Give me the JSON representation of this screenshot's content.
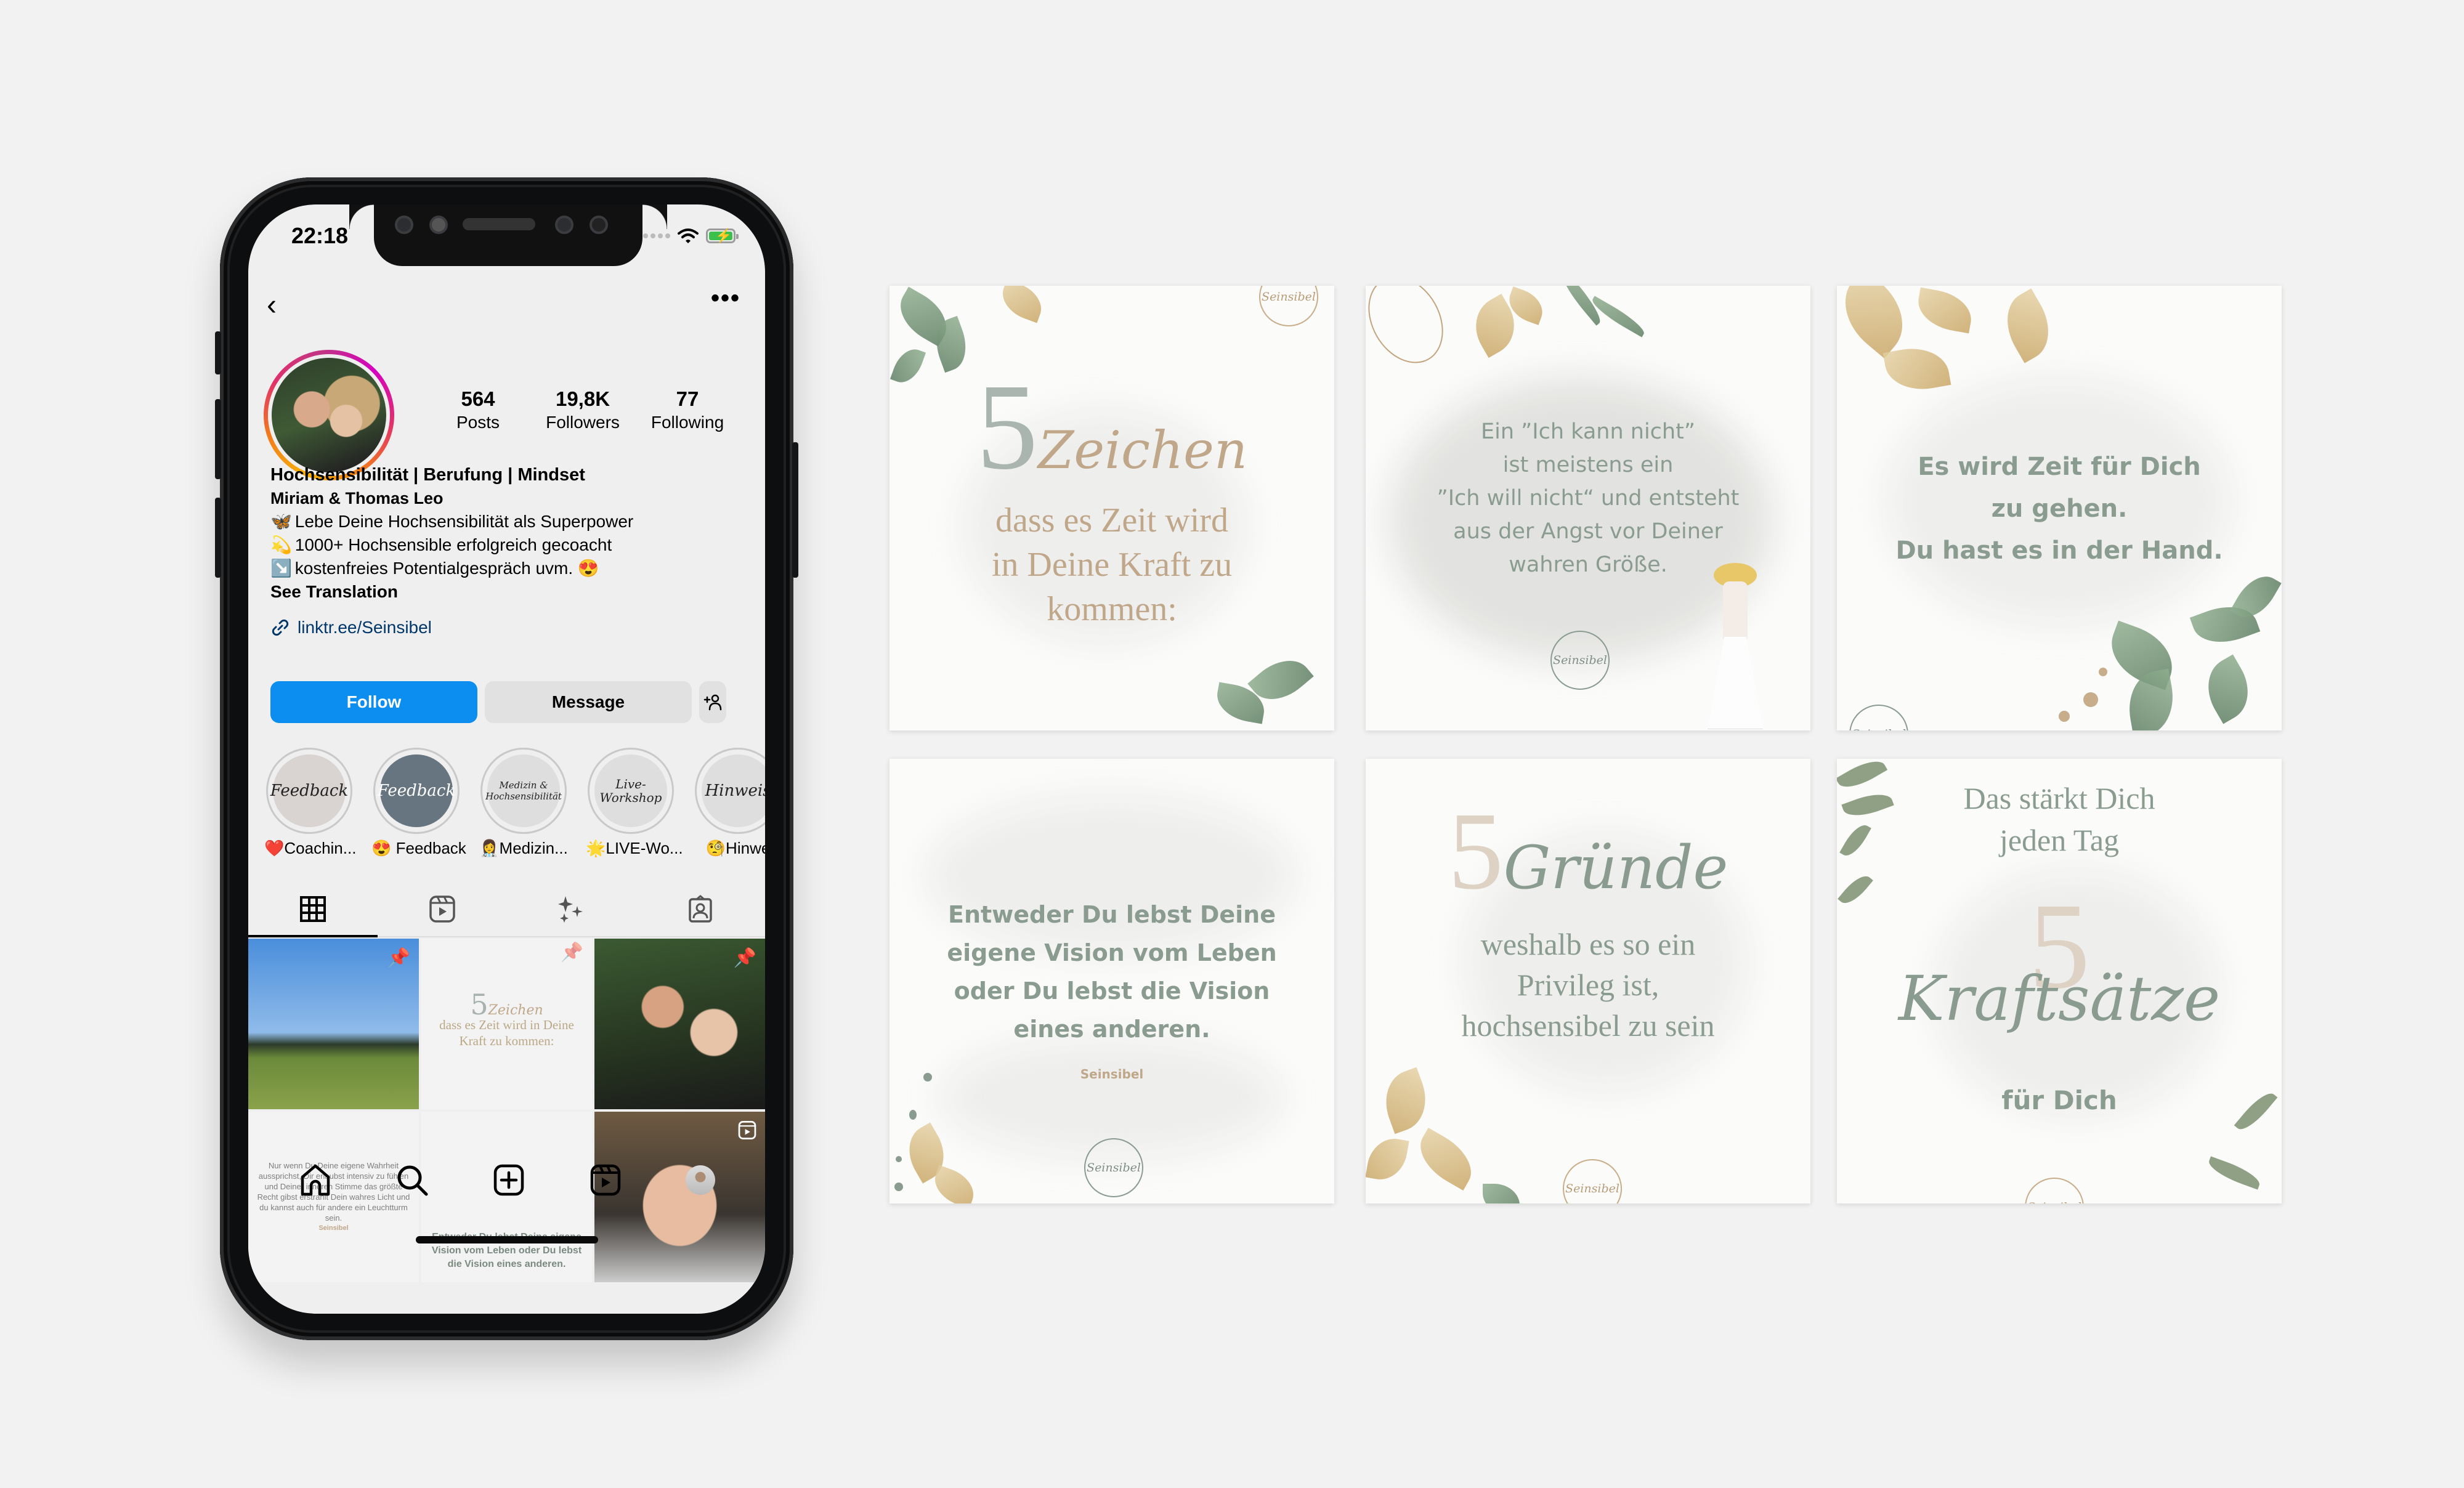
{
  "phone": {
    "status_bar": {
      "time": "22:18",
      "wifi_icon": "wifi-icon",
      "battery_icon": "battery-charging-icon",
      "battery_color": "#3cc04d"
    },
    "nav": {
      "back_icon": "chevron-left-icon",
      "more_icon": "more-horizontal-icon",
      "back_glyph": "‹",
      "more_glyph": "•••"
    },
    "profile": {
      "stats": [
        {
          "value": "564",
          "label": "Posts"
        },
        {
          "value": "19,8K",
          "label": "Followers"
        },
        {
          "value": "77",
          "label": "Following"
        }
      ],
      "headline": "Hochsensibilität | Berufung | Mindset",
      "name": "Miriam & Thomas Leo",
      "bio_lines": [
        {
          "emoji": "🦋",
          "text": "Lebe Deine Hochsensibilität als Superpower"
        },
        {
          "emoji": "💫",
          "text": "1000+ Hochsensible erfolgreich gecoacht"
        },
        {
          "emoji": "↘️",
          "text": "kostenfreies Potentialgespräch uvm. 😍"
        }
      ],
      "see_translation": "See Translation",
      "link": "linktr.ee/Seinsibel"
    },
    "buttons": {
      "follow": "Follow",
      "message": "Message",
      "add_user_glyph": "+👤"
    },
    "highlights": [
      {
        "cover_text": "Feedback",
        "label": "❤️Coachin...",
        "cover_color": "#d9d3d1",
        "text_color": "#222222"
      },
      {
        "cover_text": "Feedback",
        "label": "😍 Feedback",
        "cover_color": "#667580",
        "text_color": "#ffffff"
      },
      {
        "cover_text": "Medizin & Hochsensibilität",
        "label": "👩‍⚕️Medizin...",
        "cover_color": "#dedede",
        "text_color": "#222222"
      },
      {
        "cover_text": "Live-Workshop",
        "label": "🌟LIVE-Wo...",
        "cover_color": "#dedede",
        "text_color": "#222222"
      },
      {
        "cover_text": "Hinweis",
        "label": "🧐Hinwe",
        "cover_color": "#dedede",
        "text_color": "#222222"
      }
    ],
    "tabs": [
      {
        "name": "posts-grid",
        "icon": "grid-icon",
        "active": true
      },
      {
        "name": "reels",
        "icon": "reels-icon",
        "active": false
      },
      {
        "name": "effects",
        "icon": "sparkles-icon",
        "active": false
      },
      {
        "name": "tagged",
        "icon": "tagged-user-icon",
        "active": false
      }
    ],
    "grid_posts": [
      {
        "type": "photo",
        "desc": "woman in field",
        "pinned": true
      },
      {
        "type": "text",
        "big": "5",
        "script": "Zeichen",
        "text": "dass es Zeit wird in Deine Kraft zu kommen:",
        "pinned": true
      },
      {
        "type": "photo",
        "desc": "couple selfie",
        "pinned": true
      },
      {
        "type": "text",
        "text": "Nur wenn Du Deine eigene Wahrheit aussprichst, Dir erlaubst intensiv zu fühlen und Deiner inneren Stimme das größte Recht gibst erstrahlt Dein wahres Licht und du kannst auch für andere ein Leuchtturm sein.",
        "signature": "Seinsibel"
      },
      {
        "type": "text",
        "text": "Entweder Du lebst Deine eigene Vision vom Leben oder Du lebst die Vision eines anderen."
      },
      {
        "type": "reel",
        "desc": "woman selfie",
        "reel_icon": "reels-icon"
      }
    ],
    "bottom_nav": [
      {
        "name": "home",
        "icon": "home-icon"
      },
      {
        "name": "search",
        "icon": "search-icon"
      },
      {
        "name": "create",
        "icon": "plus-square-icon"
      },
      {
        "name": "reels",
        "icon": "reels-icon"
      },
      {
        "name": "profile",
        "icon": "profile-avatar"
      }
    ]
  },
  "posts": [
    {
      "id": "zeichen",
      "big_number": "5",
      "script_word": "Zeichen",
      "lines": [
        "dass es Zeit wird",
        "in Deine Kraft zu",
        "kommen:"
      ],
      "logo": "Seinsibel"
    },
    {
      "id": "ich-kann-nicht",
      "lines": [
        "Ein ”Ich kann nicht”",
        "ist meistens ein",
        "”Ich will nicht“ und entsteht",
        "aus der Angst vor Deiner",
        "wahren Größe."
      ],
      "logo": "Seinsibel"
    },
    {
      "id": "zeit-fuer-dich",
      "lines": [
        "Es wird Zeit für Dich",
        "zu gehen.",
        "Du hast es in der Hand."
      ],
      "logo": "Seinsibel"
    },
    {
      "id": "vision",
      "lines": [
        "Entweder Du lebst Deine",
        "eigene Vision vom Leben",
        "oder Du lebst die Vision",
        "eines anderen."
      ],
      "signature": "Seinsibel",
      "logo": "Seinsibel"
    },
    {
      "id": "gruende",
      "big_number": "5",
      "script_word": "Gründe",
      "lines": [
        "weshalb es so ein",
        "Privileg ist,",
        "hochsensibel zu sein"
      ],
      "logo": "Seinsibel"
    },
    {
      "id": "kraftsaetze",
      "top_lines": [
        "Das stärkt Dich",
        "jeden Tag"
      ],
      "big_number": "5",
      "script_word": "Kraftsätze",
      "bottom_line": "für Dich",
      "logo": "Seinsibel"
    }
  ],
  "colors": {
    "background": "#f2f2f2",
    "follow_blue": "#0c8ef0",
    "sage": "#8a9b90",
    "tan": "#c0a78a",
    "link_blue": "#00376b"
  }
}
